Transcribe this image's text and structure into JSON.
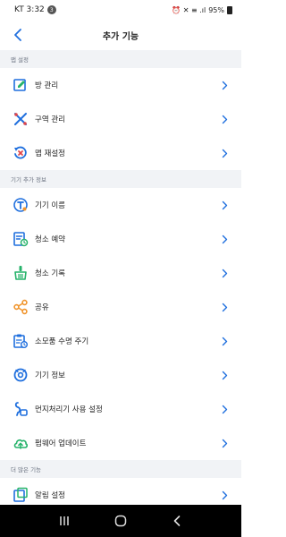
{
  "status": {
    "carrier_time": "KT 3:32",
    "badge": "3",
    "indicators": "⏰ ✕ ≡ .ıl",
    "battery": "95%"
  },
  "header": {
    "title": "추가 기능"
  },
  "sections": [
    {
      "title": "맵 설정",
      "items": [
        {
          "label": "방 관리",
          "icon": "room-edit-icon"
        },
        {
          "label": "구역 관리",
          "icon": "zone-icon"
        },
        {
          "label": "맵 재설정",
          "icon": "map-reset-icon"
        }
      ]
    },
    {
      "title": "기기 추가 정보",
      "items": [
        {
          "label": "기기 이름",
          "icon": "device-name-icon"
        },
        {
          "label": "청소 예약",
          "icon": "schedule-icon"
        },
        {
          "label": "청소 기록",
          "icon": "broom-icon"
        },
        {
          "label": "공유",
          "icon": "share-icon"
        },
        {
          "label": "소모품 수명 주기",
          "icon": "consumables-icon"
        },
        {
          "label": "기기 정보",
          "icon": "device-info-icon"
        },
        {
          "label": "먼지처리기 사용 설정",
          "icon": "dust-station-icon"
        },
        {
          "label": "펌웨어 업데이트",
          "icon": "firmware-update-icon"
        }
      ]
    },
    {
      "title": "더 많은 기능",
      "items": [
        {
          "label": "알림 설정",
          "icon": "notification-icon"
        }
      ]
    }
  ],
  "colors": {
    "accent": "#1f6fde",
    "section_bg": "#f1f3f6",
    "green": "#27b36b",
    "red": "#e0454a",
    "orange": "#f0942b"
  }
}
